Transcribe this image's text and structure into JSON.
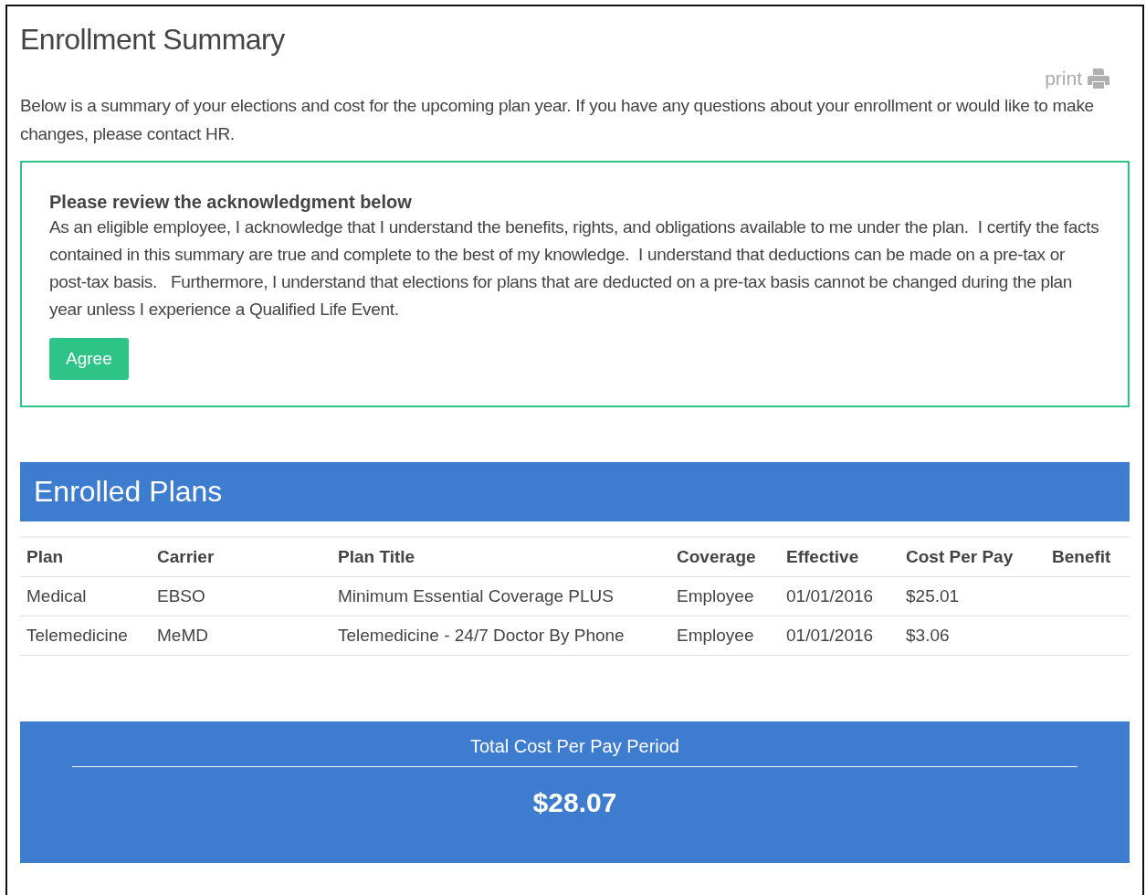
{
  "page": {
    "title": "Enrollment Summary",
    "print_link": "print",
    "intro": "Below is a summary of your elections and cost for the upcoming plan year. If you have any questions about your enrollment or would like to make changes, please contact HR."
  },
  "acknowledgment": {
    "heading": "Please review the acknowledgment below",
    "text": "As an eligible employee, I acknowledge that I understand the benefits, rights, and obligations available to me under the plan.  I certify the facts contained in this summary are true and complete to the best of my knowledge.  I understand that deductions can be made on a pre-tax or post-tax basis.   Furthermore, I understand that elections for plans that are deducted on a pre-tax basis cannot be changed during the plan year unless I experience a Qualified Life Event.",
    "button": "Agree"
  },
  "enrolled_plans": {
    "title": "Enrolled Plans",
    "columns": [
      "Plan",
      "Carrier",
      "Plan Title",
      "Coverage",
      "Effective",
      "Cost Per Pay",
      "Benefit"
    ],
    "rows": [
      [
        "Medical",
        "EBSO",
        "Minimum Essential Coverage PLUS",
        "Employee",
        "01/01/2016",
        "$25.01"
      ],
      [
        "Telemedicine",
        "MeMD",
        "Telemedicine - 24/7 Doctor By Phone",
        "Employee",
        "01/01/2016",
        "$3.06"
      ]
    ]
  },
  "total": {
    "label": "Total Cost Per Pay Period",
    "amount": "$28.07"
  }
}
